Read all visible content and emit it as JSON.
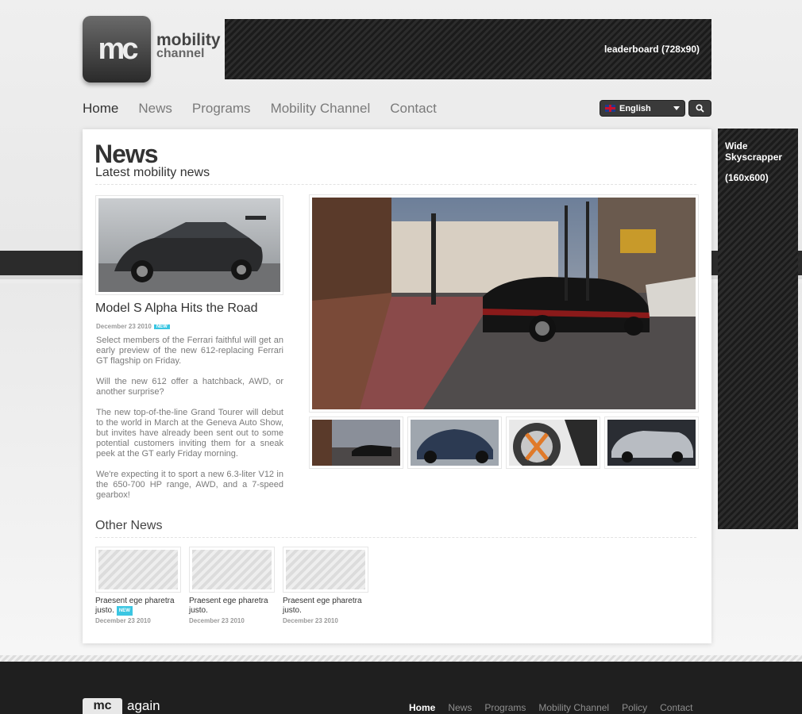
{
  "header": {
    "logo_mark": "mc",
    "logo_line1": "mobility",
    "logo_line2": "channel",
    "leaderboard_label": "leaderboard  (728x90)"
  },
  "nav": {
    "items": [
      {
        "label": "Home",
        "active": true
      },
      {
        "label": "News"
      },
      {
        "label": "Programs"
      },
      {
        "label": "Mobility Channel"
      },
      {
        "label": "Contact"
      }
    ]
  },
  "language": {
    "selected": "English",
    "icon": "uk-flag-icon"
  },
  "search": {
    "icon": "search-icon"
  },
  "skyscraper": {
    "label": "Wide Skyscrapper",
    "size": "(160x600)"
  },
  "page": {
    "title": "News",
    "subtitle": "Latest mobility news"
  },
  "article": {
    "title": "Model S Alpha Hits the Road",
    "date": "December 23 2010",
    "badge": "NEW",
    "paragraphs": [
      "Select members of the Ferrari faithful will get an early preview of the new 612-replacing Ferrari GT flagship on Friday.",
      "Will the new 612 offer a hatchback, AWD, or another surprise?",
      "The new top-of-the-line Grand Tourer will debut to the world in March at the Geneva Auto Show, but invites have already been sent out to some potential customers inviting them for a sneak peek at the GT early Friday morning.",
      "We're expecting it to sport a new 6.3-liter V12 in the 650-700 HP range, AWD, and a 7-speed gearbox!"
    ]
  },
  "gallery": {
    "thumbnails": [
      "thumb-street-car",
      "thumb-blue-supercar",
      "thumb-wheel",
      "thumb-silver-wagon"
    ]
  },
  "other_news": {
    "title": "Other News",
    "items": [
      {
        "title": "Praesent ege pharetra justo.",
        "date": "December 23 2010",
        "badge": "NEW"
      },
      {
        "title": "Praesent ege pharetra justo.",
        "date": "December 23 2010"
      },
      {
        "title": "Praesent ege pharetra justo.",
        "date": "December 23 2010"
      }
    ]
  },
  "footer": {
    "logo_mark": "mc",
    "logo_text": "again",
    "nav": [
      {
        "label": "Home",
        "active": true
      },
      {
        "label": "News"
      },
      {
        "label": "Programs"
      },
      {
        "label": "Mobility Channel"
      },
      {
        "label": "Policy"
      },
      {
        "label": "Contact"
      }
    ]
  },
  "colors": {
    "accent_badge": "#3bc6e2",
    "dark": "#2b2b2b"
  }
}
